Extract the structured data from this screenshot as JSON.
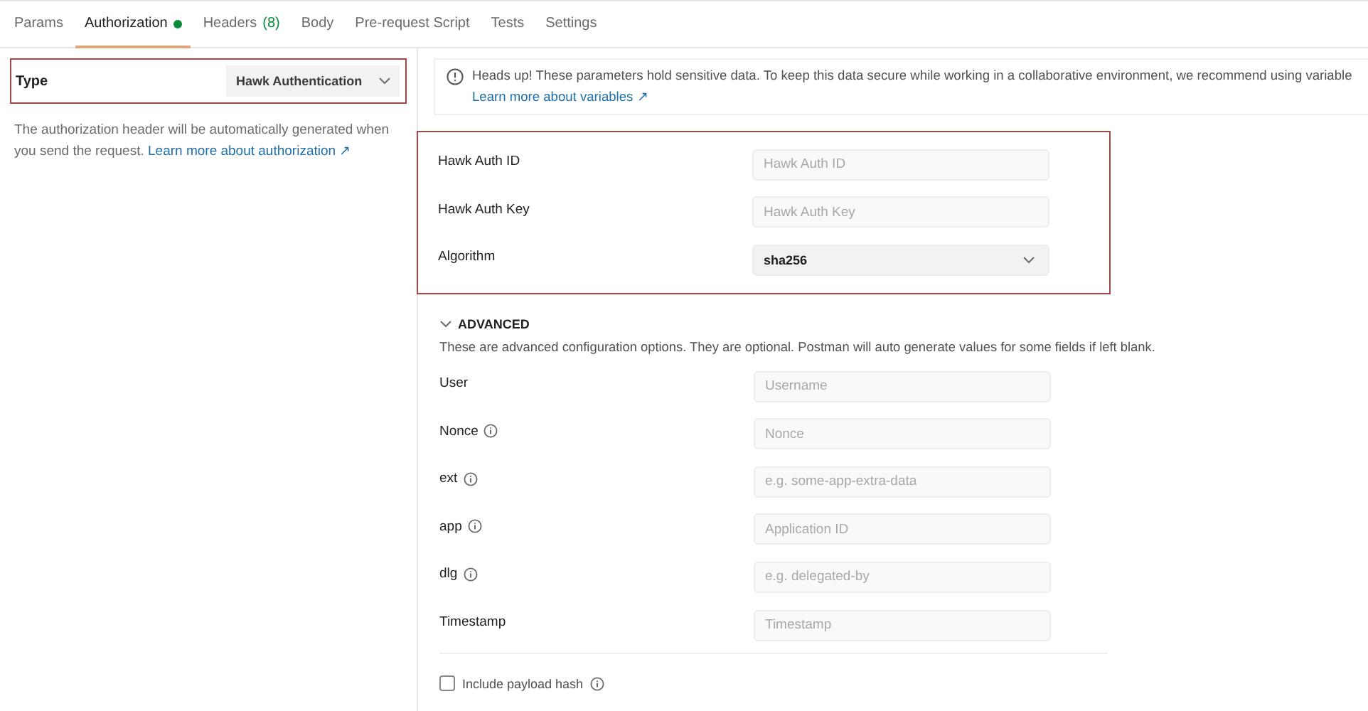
{
  "tabs": [
    {
      "label": "Params",
      "selected": false,
      "indicator": false
    },
    {
      "label": "Authorization",
      "selected": true,
      "indicator": true
    },
    {
      "label": "Headers",
      "count": "(8)",
      "selected": false,
      "indicator": false
    },
    {
      "label": "Body",
      "selected": false,
      "indicator": false
    },
    {
      "label": "Pre-request Script",
      "selected": false,
      "indicator": false
    },
    {
      "label": "Tests",
      "selected": false,
      "indicator": false
    },
    {
      "label": "Settings",
      "selected": false,
      "indicator": false
    }
  ],
  "type_selector": {
    "label": "Type",
    "value": "Hawk Authentication",
    "highlighted": true
  },
  "description": {
    "text": "The authorization header will be automatically generated when you send the request.",
    "link": "Learn more about authorization ↗"
  },
  "notice": {
    "text": "Heads up! These parameters hold sensitive data. To keep this data secure while working in a collaborative environment, we recommend using variable",
    "link": "Learn more about variables ↗"
  },
  "main_fields": {
    "highlighted": true,
    "fields": [
      {
        "kind": "input",
        "label": "Hawk Auth ID",
        "placeholder": "Hawk Auth ID",
        "info": false
      },
      {
        "kind": "input",
        "label": "Hawk Auth Key",
        "placeholder": "Hawk Auth Key",
        "info": false
      },
      {
        "kind": "select",
        "label": "Algorithm",
        "value": "sha256",
        "info": false
      }
    ]
  },
  "advanced": {
    "title": "ADVANCED",
    "expanded": true,
    "description": "These are advanced configuration options. They are optional. Postman will auto generate values for some fields if left blank.",
    "fields": [
      {
        "kind": "input",
        "label": "User",
        "placeholder": "Username",
        "info": false
      },
      {
        "kind": "input",
        "label": "Nonce",
        "placeholder": "Nonce",
        "info": true
      },
      {
        "kind": "input",
        "label": "ext",
        "placeholder": "e.g. some-app-extra-data",
        "info": true
      },
      {
        "kind": "input",
        "label": "app",
        "placeholder": "Application ID",
        "info": true
      },
      {
        "kind": "input",
        "label": "dlg",
        "placeholder": "e.g. delegated-by",
        "info": true
      },
      {
        "kind": "input",
        "label": "Timestamp",
        "placeholder": "Timestamp",
        "info": false
      }
    ],
    "checkbox": {
      "label": "Include payload hash",
      "checked": false,
      "info": true
    }
  }
}
